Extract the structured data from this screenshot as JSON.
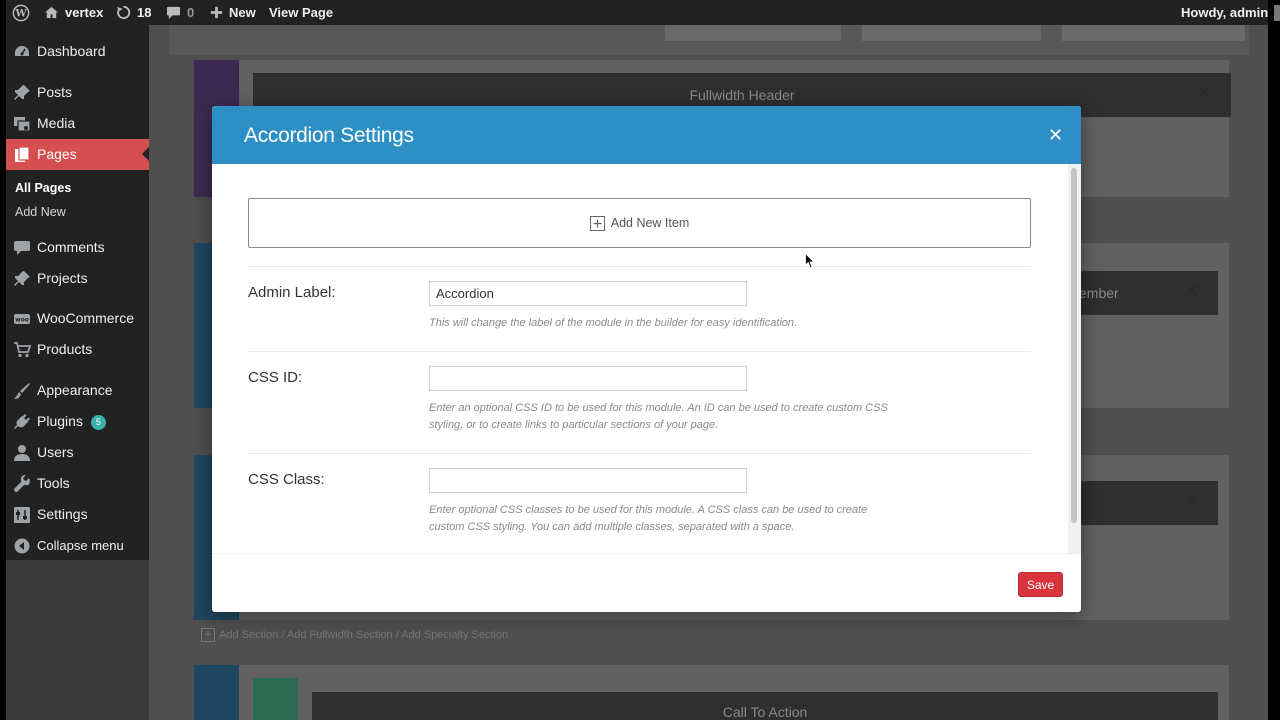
{
  "adminbar": {
    "site_name": "vertex",
    "updates_count": "18",
    "comments_count": "0",
    "new_label": "New",
    "view_page_label": "View Page",
    "howdy": "Howdy, admin"
  },
  "sidebar": {
    "items": [
      {
        "label": "Dashboard",
        "icon": "dashboard-icon"
      },
      {
        "label": "Posts",
        "icon": "pin-icon"
      },
      {
        "label": "Media",
        "icon": "media-icon"
      },
      {
        "label": "Pages",
        "icon": "pages-icon"
      },
      {
        "label": "Comments",
        "icon": "comment-icon"
      },
      {
        "label": "Projects",
        "icon": "pin-icon"
      },
      {
        "label": "WooCommerce",
        "icon": "woocommerce-icon"
      },
      {
        "label": "Products",
        "icon": "cart-icon"
      },
      {
        "label": "Appearance",
        "icon": "brush-icon"
      },
      {
        "label": "Plugins",
        "icon": "plug-icon"
      },
      {
        "label": "Users",
        "icon": "user-icon"
      },
      {
        "label": "Tools",
        "icon": "wrench-icon"
      },
      {
        "label": "Settings",
        "icon": "settings-icon"
      }
    ],
    "plugins_badge": "5",
    "submenu": [
      "All Pages",
      "Add New"
    ],
    "collapse_label": "Collapse menu"
  },
  "builder": {
    "fullwidth_header": "Fullwidth Header",
    "member_partial": "ember",
    "add_section_links": "Add Section / Add Fullwidth Section / Add Specialty Section",
    "call_to_action": "Call To Action"
  },
  "modal": {
    "title": "Accordion Settings",
    "add_item_label": "Add New Item",
    "fields": [
      {
        "label": "Admin Label:",
        "value": "Accordion",
        "description": "This will change the label of the module in the builder for easy identification."
      },
      {
        "label": "CSS ID:",
        "value": "",
        "description": "Enter an optional CSS ID to be used for this module. An ID can be used to create custom CSS styling, or to create links to particular sections of your page."
      },
      {
        "label": "CSS Class:",
        "value": "",
        "description": "Enter optional CSS classes to be used for this module. A CSS class can be used to create custom CSS styling. You can add multiple classes, separated with a space."
      }
    ],
    "save_label": "Save"
  },
  "colors": {
    "modal_header": "#2e8fc4",
    "active_menu": "#d54e50",
    "save_button": "#d9343d",
    "admin_bar": "#222222"
  }
}
